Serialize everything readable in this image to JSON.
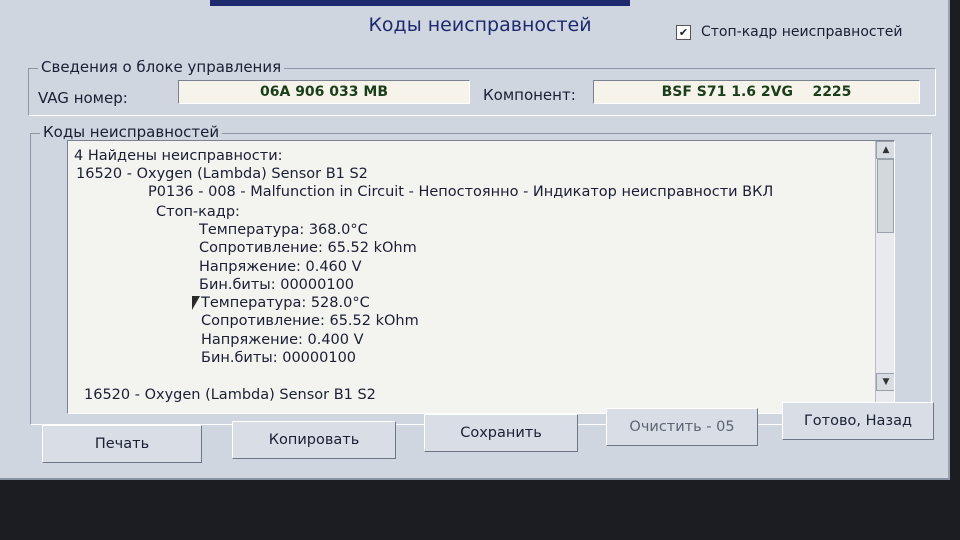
{
  "header": {
    "title": "Коды неисправностей",
    "freeze_frame": {
      "label": "Стоп-кадр неисправностей",
      "checked": true
    }
  },
  "control_unit": {
    "group_label": "Сведения о блоке управления",
    "vag_label": "VAG номер:",
    "vag_number": "06A 906 033 MB",
    "component_label": "Компонент:",
    "component": "BSF S71 1.6 2VG    2225"
  },
  "faults": {
    "group_label": "Коды неисправностей",
    "lines": [
      "4 Найдены неисправности:",
      "16520 - Oxygen (Lambda) Sensor B1 S2",
      "P0136 - 008 - Malfunction in Circuit - Непостоянно - Индикатор неисправности ВКЛ",
      "Стоп-кадр:",
      "Температура: 368.0°C",
      "Сопротивление: 65.52 kOhm",
      "Напряжение: 0.460 V",
      "Бин.биты: 00000100",
      "Температура: 528.0°C",
      "Сопротивление: 65.52 kOhm",
      "Напряжение: 0.400 V",
      "Бин.биты: 00000100",
      "16520 - Oxygen (Lambda) Sensor B1 S2"
    ]
  },
  "buttons": {
    "print": "Печать",
    "copy": "Копировать",
    "save": "Сохранить",
    "clear": "Очистить - 05",
    "done": "Готово, Назад"
  },
  "icons": {
    "scroll_up": "triangle-up",
    "scroll_down": "triangle-down",
    "cursor": "mouse-pointer"
  }
}
